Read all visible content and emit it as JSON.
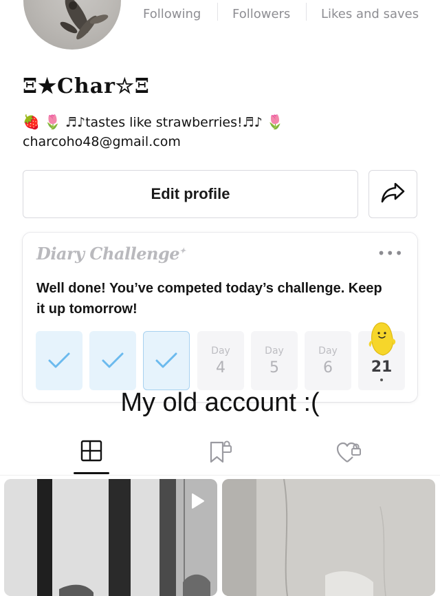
{
  "profile": {
    "display_name": "Ξ★Char☆Ξ",
    "bio_text": "tastes like strawberries!",
    "bio_emoji_strawberry": "🍓",
    "bio_emoji_tulip": "🌷",
    "bio_notes_left": "♬♪",
    "bio_notes_right": "♬♪",
    "email": "charcoho48@gmail.com"
  },
  "stats": {
    "following_label": "Following",
    "followers_label": "Followers",
    "likes_label": "Likes and saves"
  },
  "actions": {
    "edit_profile_label": "Edit profile",
    "share_icon": "share-arrow-icon"
  },
  "diary": {
    "logo_text": "Diary Challenge",
    "more_label": "•••",
    "message": "Well done! You’ve competed today’s challenge. Keep it up tomorrow!",
    "days": [
      {
        "state": "done"
      },
      {
        "state": "done"
      },
      {
        "state": "today"
      },
      {
        "state": "pending",
        "label": "Day",
        "number": "4"
      },
      {
        "state": "pending",
        "label": "Day",
        "number": "5"
      },
      {
        "state": "pending",
        "label": "Day",
        "number": "6"
      },
      {
        "state": "streak",
        "number": "21"
      }
    ]
  },
  "caption": "My old account :(",
  "tabs": [
    {
      "name": "posts",
      "icon": "grid-layout-icon",
      "selected": true
    },
    {
      "name": "collections",
      "icon": "bookmark-lock-icon",
      "selected": false
    },
    {
      "name": "liked",
      "icon": "heart-lock-icon",
      "selected": false
    }
  ],
  "colors": {
    "accent_blue": "#5fb1ea",
    "check_bg": "#e6f3fc",
    "muted_text": "#8d8d92"
  }
}
